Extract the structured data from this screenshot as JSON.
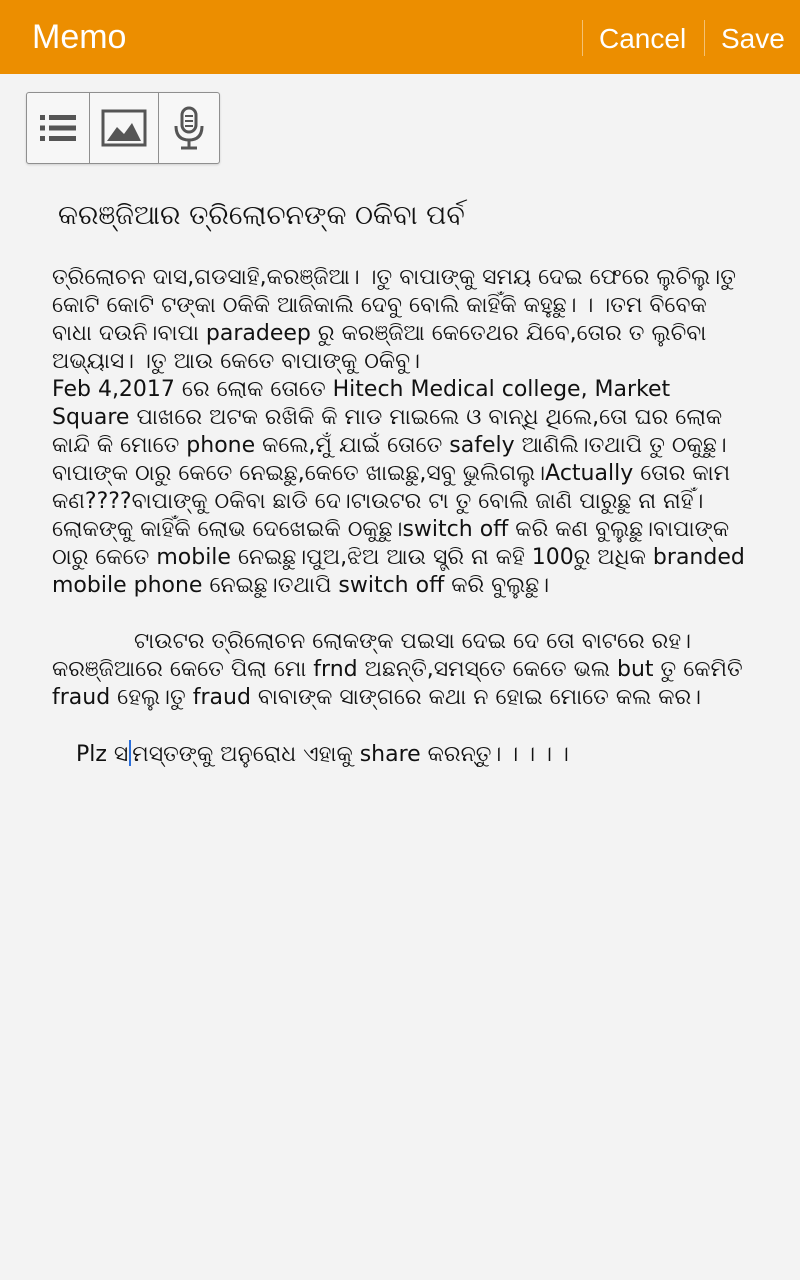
{
  "app_bar": {
    "title": "Memo",
    "cancel_label": "Cancel",
    "save_label": "Save",
    "accent_color": "#ec8e00"
  },
  "toolbar": {
    "buttons": [
      {
        "icon": "list-icon"
      },
      {
        "icon": "image-icon"
      },
      {
        "icon": "microphone-icon"
      }
    ]
  },
  "memo": {
    "heading": "କରଞ୍ଜିଆର ତ୍ରିଲୋଚନଙ୍କ ଠକିବା ପର୍ବ",
    "paragraph1": "ତ୍ରିଲୋଚନ ଦାସ,ଗଡସାହି,କରଞ୍ଜିଆ। ।ତୁ ବାପାଙ୍କୁ ସମୟ ଦେଇ ଫେରେ ଲୁଚିଲୁ।ତୁ କୋଟି କୋଟି ଟଙ୍କା ଠକିକି ଆଜିକାଲି ଦେବୁ ବୋଲି କାହିଁକି କହୁଛୁ। । ।ତମ ବିବେକ ବାଧା ଦଉନି।ବାପା paradeep ରୁ କରଞ୍ଜିଆ କେତେଥର ଯିବେ,ତୋର ତ ଲୁଚିବା ଅଭ୍ୟାସ। ।ତୁ ଆଉ କେତେ ବାପାଙ୍କୁ ଠକିବୁ।",
    "paragraph2": "Feb 4,2017 ରେ ଲୋକ ତୋତେ Hitech Medical college, Market Square ପାଖରେ ଅଟକ ରଖିକି କି ମାଡ ମାଇଲେ ଓ ବାନ୍ଧି ଥିଲେ,ତୋ ଘର ଲୋକ କାନ୍ଦି କି ମୋତେ phone କଲେ,ମୁଁ ଯାଇଁ ତୋତେ safely ଆଣିଲି।ତଥାପି ତୁ ଠକୁଛୁ।ବାପାଙ୍କ ଠାରୁ କେତେ ନେଇଛୁ,କେତେ ଖାଇଛୁ,ସବୁ ଭୁଲିଗଲୁ।Actually ତୋର କାମ କଣ????ବାପାଙ୍କୁ ଠକିବା ଛାଡି ଦେ।ଟାଉଟର ଟା ତୁ ବୋଲି ଜାଣି ପାରୁଛୁ ନା ନାହିଁ।ଲୋକଙ୍କୁ କାହିଁକି ଲୋଭ ଦେଖେଇକି ଠକୁଛୁ।switch off କରି କଣ ବୁଲୁଛୁ।ବାପାଙ୍କ ଠାରୁ କେତେ mobile ନେଇଛୁ।ପୁଅ,ଝିଅ ଆଉ ସ୍ତ୍ରି ନା କହି 100ରୁ ଅଧିକ branded mobile phone ନେଇଛୁ।ତଥାପି switch off କରି ବୁଲୁଛୁ।",
    "paragraph3": "ଟାଉଟର ତ୍ରିଲୋଚନ ଲୋକଙ୍କ ପଇସା ଦେଇ ଦେ ତୋ ବାଟରେ ରହ।କରଞ୍ଜିଆରେ କେତେ ପିଲା ମୋ frnd ଅଛନ୍ତି,ସମସ୍ତେ କେତେ ଭଲ but ତୁ କେମିତି fraud ହେଲୁ।ତୁ fraud ବାବାଙ୍କ ସାଙ୍ଗରେ କଥା ନ ହୋଇ ମୋତେ କଲ କର।",
    "closing_before_cursor": "Plz  ସ",
    "closing_after_cursor": "ମସ୍ତଙ୍କୁ ଅନୁରୋଧ ଏହାକୁ share କରନ୍ତୁ। । । । ।"
  }
}
